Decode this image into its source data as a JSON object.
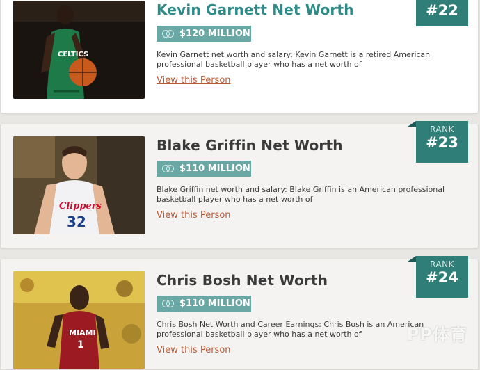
{
  "people": [
    {
      "name": "Kevin Garnett Net Worth",
      "worth": "$120 MILLION",
      "description": "Kevin Garnett net worth and salary: Kevin Garnett is a retired American professional basketball player who has a net worth of",
      "view_label": "View this Person",
      "rank_label": "",
      "rank": "#22"
    },
    {
      "name": "Blake Griffin Net Worth",
      "worth": "$110 MILLION",
      "description": "Blake Griffin net worth and salary: Blake Griffin is an American professional basketball player who has a net worth of",
      "view_label": "View this Person",
      "rank_label": "RANK",
      "rank": "#23"
    },
    {
      "name": "Chris Bosh Net Worth",
      "worth": "$110 MILLION",
      "description": "Chris Bosh Net Worth and Career Earnings: Chris Bosh is an American professional basketball player who has a net worth of",
      "view_label": "View this Person",
      "rank_label": "RANK",
      "rank": "#24"
    }
  ],
  "watermark": "PP体育",
  "colors": {
    "teal": "#2f8b88",
    "badge": "#6aa8a6",
    "rank_ribbon": "#2f7f78",
    "link": "#b85a36"
  },
  "icons": {
    "worth": "coins-icon"
  }
}
